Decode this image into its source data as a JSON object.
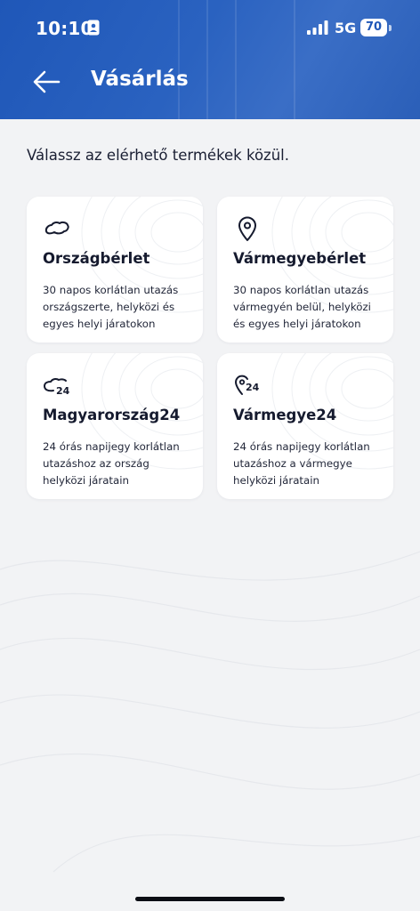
{
  "status_bar": {
    "time": "10:10",
    "network": "5G",
    "battery": "70"
  },
  "header": {
    "title": "Vásárlás"
  },
  "intro": "Válassz az elérhető termékek közül.",
  "products": [
    {
      "icon": "country-map-icon",
      "title": "Országbérlet",
      "description": "30 napos korlátlan utazás országszerte, helyközi és egyes helyi járatokon"
    },
    {
      "icon": "location-pin-icon",
      "title": "Vármegyebérlet",
      "description": "30 napos korlátlan utazás vármegyén belül, helyközi és egyes helyi járatokon"
    },
    {
      "icon": "country-map-24-icon",
      "title": "Magyarország24",
      "description": "24 órás napijegy korlátlan utazáshoz az ország helyközi járatain"
    },
    {
      "icon": "location-pin-24-icon",
      "title": "Vármegye24",
      "description": "24 órás napijegy korlátlan utazáshoz a vármegye helyközi járatain"
    }
  ],
  "colors": {
    "header_blue": "#1f57b8",
    "text_dark": "#151a2e",
    "page_bg": "#f2f3f5",
    "card_bg": "#ffffff"
  }
}
